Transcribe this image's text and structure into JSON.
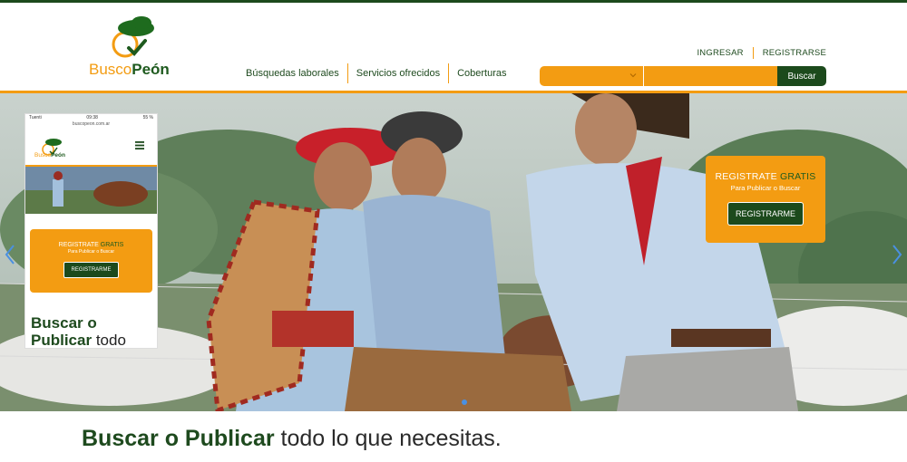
{
  "brand": {
    "name_part1": "Busco",
    "name_part2": "Peón"
  },
  "nav": {
    "items": [
      {
        "label": "Búsquedas laborales"
      },
      {
        "label": "Servicios ofrecidos"
      },
      {
        "label": "Coberturas"
      }
    ]
  },
  "auth": {
    "login": "INGRESAR",
    "register": "REGISTRARSE"
  },
  "search": {
    "category_value": "",
    "query_value": "",
    "button_label": "Buscar"
  },
  "hero": {
    "register_card": {
      "title_part1": "REGISTRATE ",
      "title_part2": "GRATIS",
      "subtitle": "Para Publicar o Buscar",
      "button_label": "REGISTRARME"
    },
    "phone": {
      "status_left": "Tuenti",
      "status_time": "09:38",
      "status_right": "55 %",
      "url": "buscopeon.com.ar",
      "brand_part1": "Busco",
      "brand_part2": "Peón",
      "card_title_part1": "REGISTRATE ",
      "card_title_part2": "GRATIS",
      "card_subtitle": "Para Publicar o Buscar",
      "card_button": "REGISTRARME",
      "tag_part1": "Buscar o",
      "tag_part2": "Publicar",
      "tag_part3": " todo"
    }
  },
  "tagline": {
    "bold": "Buscar o Publicar",
    "rest": " todo lo que necesitas."
  },
  "colors": {
    "brand_green": "#1c4a1c",
    "brand_orange": "#f39c12"
  }
}
